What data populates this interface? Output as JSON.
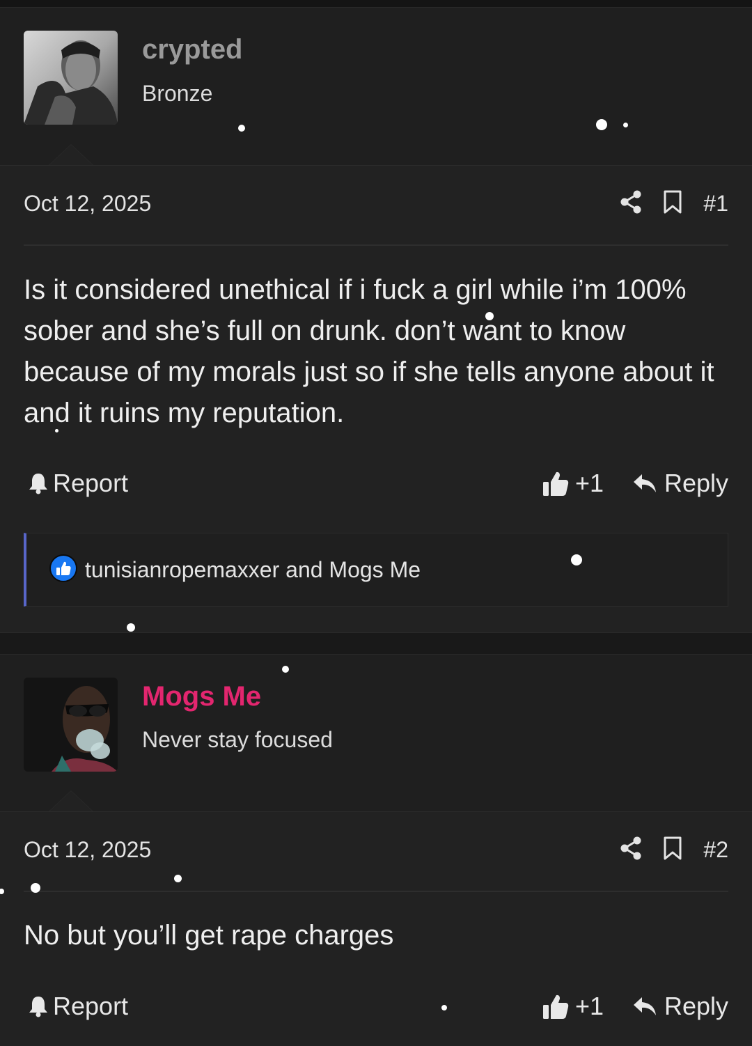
{
  "posts": [
    {
      "author": {
        "name": "crypted",
        "name_color": "#9a9a9a",
        "title": "Bronze",
        "avatar_desc": "grayscale portrait avatar"
      },
      "date": "Oct 12, 2025",
      "number": "#1",
      "message": "Is it considered unethical if i fuck a girl while i’m 100% sober and she’s full on drunk. don’t want to know because of my morals just so if she tells anyone about it and it ruins my reputation.",
      "actions": {
        "report": "Report",
        "like": "+1",
        "reply": "Reply"
      },
      "reactions": {
        "text": "tunisianropemaxxer and Mogs Me"
      }
    },
    {
      "author": {
        "name": "Mogs Me",
        "name_color": "#e3266f",
        "title": "Never stay focused",
        "avatar_desc": "dark portrait avatar with sunglasses"
      },
      "date": "Oct 12, 2025",
      "number": "#2",
      "message": "No but you’ll get rape charges",
      "actions": {
        "report": "Report",
        "like": "+1",
        "reply": "Reply"
      }
    }
  ],
  "colors": {
    "background": "#1c1c1c",
    "reaction_border": "#5866c9",
    "like_badge": "#1877f2"
  },
  "icons": [
    "share-icon",
    "bookmark-icon",
    "bell-icon",
    "thumbs-up-icon",
    "reply-arrow-icon",
    "like-reaction-icon"
  ]
}
